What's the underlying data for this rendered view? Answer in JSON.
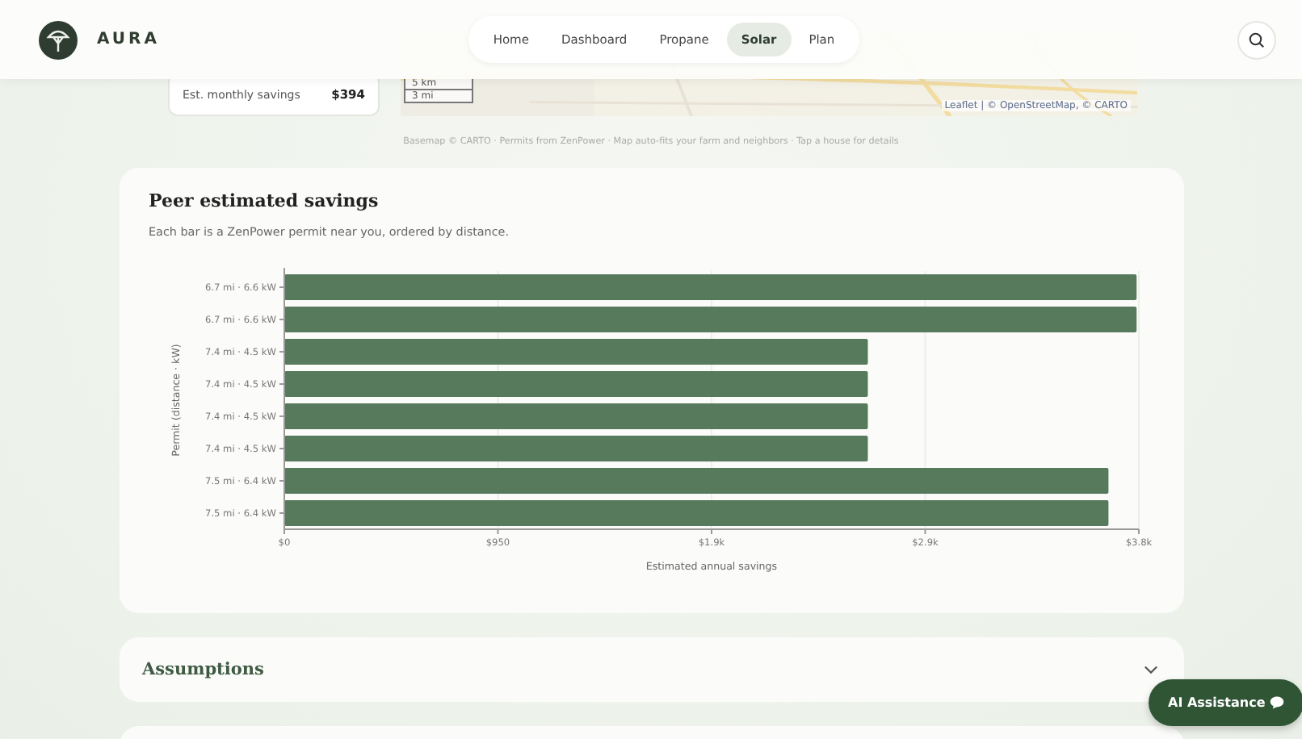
{
  "header": {
    "brand": "AURA",
    "nav": [
      {
        "label": "Home",
        "selected": false
      },
      {
        "label": "Dashboard",
        "selected": false
      },
      {
        "label": "Propane",
        "selected": false
      },
      {
        "label": "Solar",
        "selected": true
      },
      {
        "label": "Plan",
        "selected": false
      }
    ]
  },
  "map_card": {
    "savings_label": "Est. monthly savings",
    "savings_value": "$394",
    "scale": [
      "5 km",
      "3 mi"
    ],
    "attribution": "Leaflet | © OpenStreetMap, © CARTO",
    "caption": "Basemap © CARTO · Permits from ZenPower · Map auto-fits your farm and neighbors · Tap a house for details"
  },
  "peer_card": {
    "title": "Peer estimated savings",
    "subtitle": "Each bar is a ZenPower permit near you, ordered by distance.",
    "chart_data": {
      "type": "bar",
      "orientation": "horizontal",
      "xlabel": "Estimated annual savings",
      "ylabel": "Permit (distance · kW)",
      "categories": [
        "6.7 mi · 6.6 kW",
        "6.7 mi · 6.6 kW",
        "7.4 mi · 4.5 kW",
        "7.4 mi · 4.5 kW",
        "7.4 mi · 4.5 kW",
        "7.4 mi · 4.5 kW",
        "7.5 mi · 6.4 kW",
        "7.5 mi · 6.4 kW"
      ],
      "values": [
        3790,
        3790,
        2595,
        2595,
        2595,
        2595,
        3665,
        3665
      ],
      "xlim": [
        0,
        3800
      ],
      "grid": true,
      "xticks": [
        {
          "value": 0,
          "label": "$0"
        },
        {
          "value": 950,
          "label": "$950"
        },
        {
          "value": 1900,
          "label": "$1.9k"
        },
        {
          "value": 2850,
          "label": "$2.9k"
        },
        {
          "value": 3800,
          "label": "$3.8k"
        }
      ]
    }
  },
  "assumptions": {
    "title": "Assumptions",
    "expanded": false
  },
  "assistant_button": {
    "label": "AI Assistance"
  }
}
